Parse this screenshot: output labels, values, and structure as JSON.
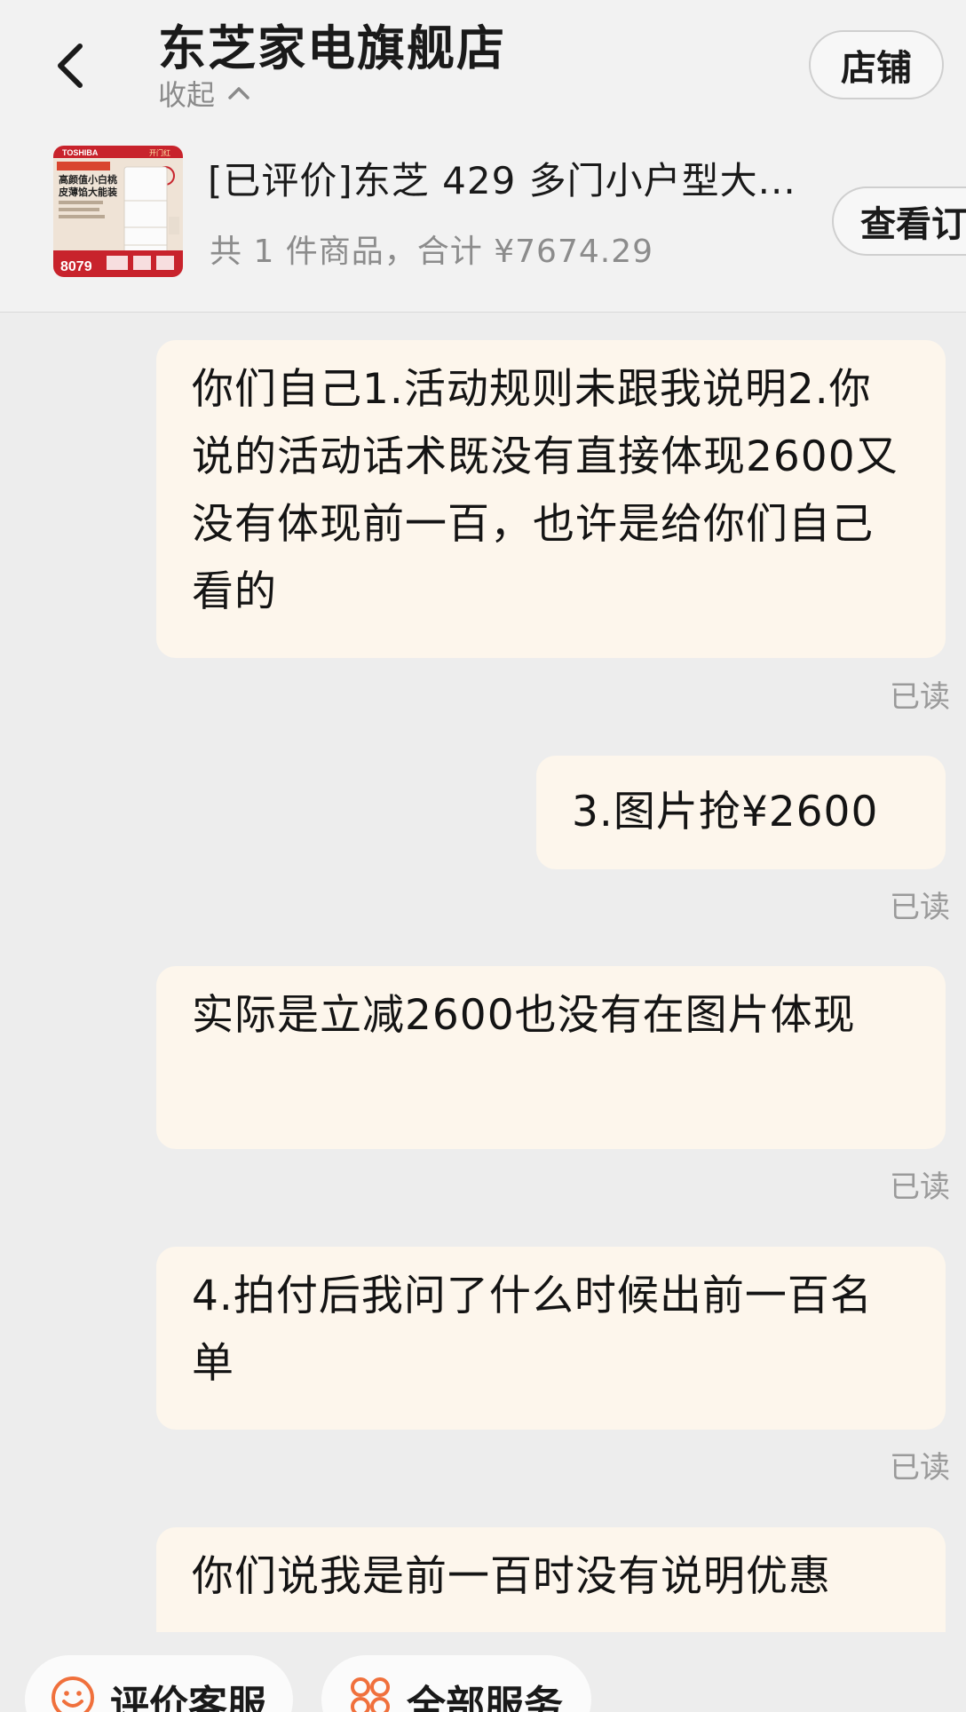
{
  "header": {
    "shop_name": "东芝家电旗舰店",
    "collapse_label": "收起",
    "store_button": "店铺"
  },
  "product": {
    "title": "[已评价]东芝 429 多门小户型大...",
    "summary": "共 1 件商品，合计 ¥7674.29",
    "view_order_button": "查看订单",
    "thumbnail": {
      "brand": "TOSHIBA",
      "tag": "开门红",
      "headline_1": "高颜值小白桃",
      "headline_2": "皮薄馅大能装",
      "price": "8079"
    }
  },
  "messages": [
    {
      "text": "你们自己1.活动规则未跟我说明2.你说的活动话术既没有直接体现2600又没有体现前一百，也许是给你们自己看的",
      "status": "已读"
    },
    {
      "text": "3.图片抢¥2600",
      "status": "已读"
    },
    {
      "text": "实际是立减2600也没有在图片体现",
      "status": "已读"
    },
    {
      "text": "4.拍付后我问了什么时候出前一百名单",
      "status": "已读"
    },
    {
      "text": "你们说我是前一百时没有说明优惠",
      "status": ""
    }
  ],
  "bottom_bar": {
    "rate_service": "评价客服",
    "all_services": "全部服务"
  },
  "colors": {
    "bubble_bg": "#fdf6ec",
    "page_bg": "#ededed",
    "icon_orange": "#f0703c"
  }
}
